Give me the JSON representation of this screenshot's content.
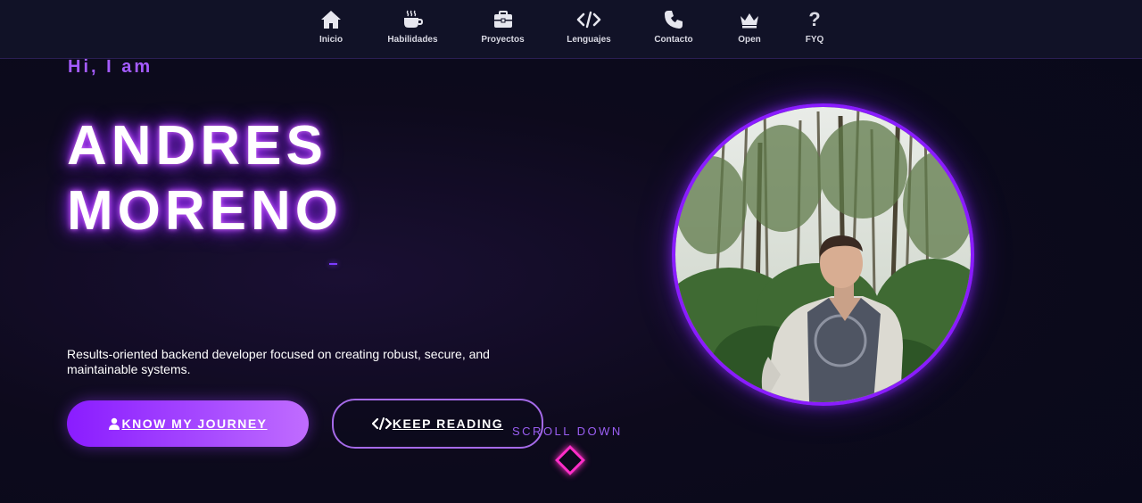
{
  "nav": {
    "items": [
      {
        "label": "Inicio",
        "icon": "home-icon"
      },
      {
        "label": "Habilidades",
        "icon": "coffee-icon"
      },
      {
        "label": "Proyectos",
        "icon": "briefcase-icon"
      },
      {
        "label": "Lenguajes",
        "icon": "code-icon"
      },
      {
        "label": "Contacto",
        "icon": "phone-icon"
      },
      {
        "label": "Open",
        "icon": "crown-icon"
      },
      {
        "label": "FYQ",
        "icon": "question-icon"
      }
    ]
  },
  "hero": {
    "greeting": "Hi, I am",
    "name_line1": "ANDRES",
    "name_line2": "MORENO",
    "description": "Results-oriented backend developer focused on creating robust, secure, and maintainable systems.",
    "primary_button": "KNOW MY JOURNEY",
    "secondary_button": "KEEP READING",
    "scroll_label": "SCROLL DOWN"
  },
  "colors": {
    "accent": "#8a1cff",
    "accent_light": "#a45bff",
    "scroll_diamond": "#ff2ec8",
    "nav_bg": "#111227"
  }
}
